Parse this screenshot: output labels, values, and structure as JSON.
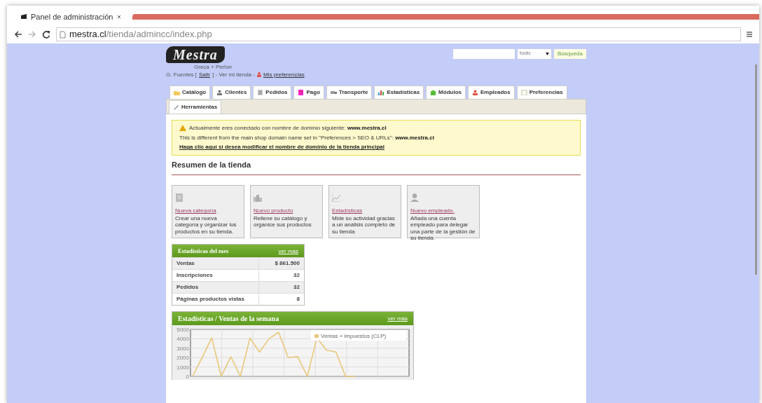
{
  "browser": {
    "tab_title": "Panel de administración",
    "url_host": "mestra.cl",
    "url_path": "/tienda/admincc/index.php"
  },
  "header": {
    "logo": "Mestra",
    "logo_tagline": "Greca + Perlon",
    "user_line": [
      {
        "text": "G. Fuentes ["
      },
      {
        "text": "Salir",
        "link": true
      },
      {
        "text": "] - Ver mi tienda -"
      },
      {
        "text": "Mis preferencias",
        "link": true
      }
    ]
  },
  "search": {
    "scope": "todo",
    "button": "Búsqueda"
  },
  "tabs": [
    {
      "label": "Catálogo"
    },
    {
      "label": "Clientes"
    },
    {
      "label": "Pedidos"
    },
    {
      "label": "Pago"
    },
    {
      "label": "Transporte"
    },
    {
      "label": "Estadísticas"
    },
    {
      "label": "Módulos"
    },
    {
      "label": "Empleados"
    },
    {
      "label": "Preferencias"
    },
    {
      "label": "Herramientas"
    }
  ],
  "warning": {
    "line_1": "Actualmente eres conectado con nombre de dominio siguiente:",
    "domain_1": "www.mestra.cl",
    "line_2": "This is different from the main shop domain name set in \"Preferences > SEO & URLs\":",
    "domain_2": "www.mestra.cl",
    "link": "Haga clic aquí si desea modificar el nombre de dominio de la tienda principal"
  },
  "section_title": "Resumen de la tienda",
  "shortcuts": [
    {
      "title": "Nueva categoría",
      "text": "Crear una nueva categoría y organizar los productos en su tienda."
    },
    {
      "title": "Nuevo producto",
      "text": "Rellene su catálogo y organice sus productos"
    },
    {
      "title": "Estadísticas",
      "text": "Mide su actividad gracias a un análisis completo de su tienda"
    },
    {
      "title": "Nuevo empleado.",
      "text": "Añada una cuenta empleado para delegar una parte de la gestión de su tienda."
    }
  ],
  "month_stats": {
    "title": "Estadísticas del mes",
    "more": "ver más",
    "rows": [
      {
        "label": "Ventas",
        "value": "$ 861.500"
      },
      {
        "label": "Inscripciones",
        "value": "32"
      },
      {
        "label": "Pedidos",
        "value": "32"
      },
      {
        "label": "Páginas productos vistas",
        "value": "8"
      }
    ]
  },
  "week_stats": {
    "title": "Estadísticas",
    "subtitle": "/ Ventas de la semana",
    "more": "ver más",
    "chart_data": {
      "type": "line",
      "grid": true,
      "yticks": [
        0,
        1000,
        2000,
        3000,
        4000,
        5000
      ],
      "ylim": [
        0,
        5000
      ],
      "series": [
        {
          "name": "Ventas + impuestos (CLP)",
          "color": "#e8c77a",
          "values": [
            0,
            2000,
            4100,
            0,
            2100,
            0,
            4100,
            2600,
            4000,
            4700,
            2000,
            2100,
            0,
            4100,
            2800,
            2600,
            0,
            0
          ]
        }
      ]
    }
  }
}
